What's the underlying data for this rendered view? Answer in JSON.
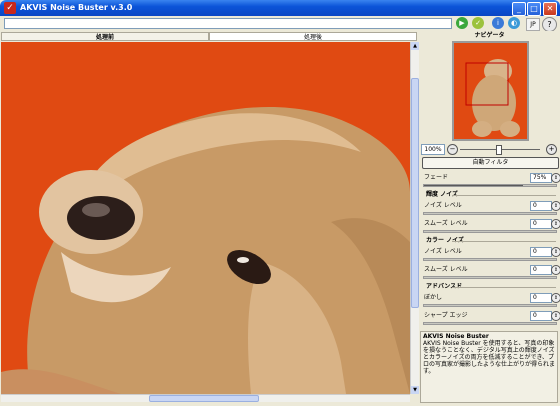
{
  "window": {
    "title": "AKVIS Noise Buster v.3.0",
    "app_icon": "akvis-logo-icon"
  },
  "toolbar": {
    "path_value": "",
    "lang": "JP",
    "help_label": "?"
  },
  "tabs": [
    {
      "label": "処理前"
    },
    {
      "label": "処理後"
    }
  ],
  "navigator": {
    "title": "ナビゲータ"
  },
  "zoom": {
    "value": "100%",
    "minus": "−",
    "plus": "+"
  },
  "auto_filter_label": "自動フィルタ",
  "fade": {
    "label": "フェード",
    "value": "75%",
    "level": 0.75
  },
  "groups": {
    "intensity": "輝度 ノイズ",
    "color": "カラー ノイズ",
    "advanced": "アドバンスド"
  },
  "params": {
    "lum_noise": {
      "label": "ノイズ レベル",
      "value": "0"
    },
    "lum_smooth": {
      "label": "スムーズ レベル",
      "value": "0"
    },
    "col_noise": {
      "label": "ノイズ レベル",
      "value": "0"
    },
    "col_smooth": {
      "label": "スムーズ レベル",
      "value": "0"
    },
    "blur": {
      "label": "ぼかし",
      "value": "0"
    },
    "sharp": {
      "label": "シャープ エッジ",
      "value": "0"
    }
  },
  "help": {
    "title": "AKVIS Noise Buster",
    "text": "AKVIS Noise Buster を使用すると、写真の印象を損なうことなく、デジタル写真上の輝度ノイズとカラーノイズの両方を低減することができ、プロの写真家が撮影したような仕上がりが得られます。"
  },
  "colors": {
    "canvas_bg": "#e04a12",
    "titlebar": "#0b54d8"
  }
}
